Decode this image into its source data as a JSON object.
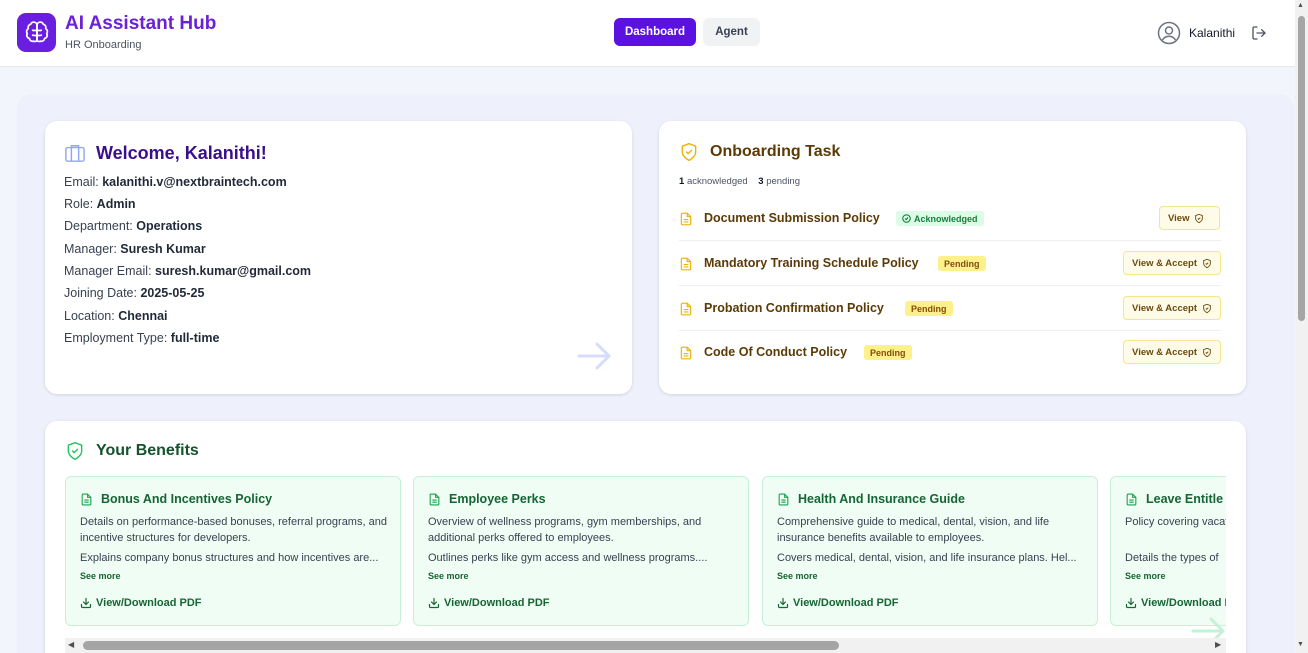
{
  "header": {
    "app_title": "AI Assistant Hub",
    "app_subtitle": "HR Onboarding",
    "nav": [
      "Dashboard",
      "Agent"
    ],
    "active_nav": "Dashboard",
    "user_name": "Kalanithi"
  },
  "welcome": {
    "title": "Welcome, Kalanithi!",
    "fields": [
      {
        "label": "Email:",
        "value": "kalanithi.v@nextbraintech.com"
      },
      {
        "label": "Role:",
        "value": "Admin"
      },
      {
        "label": "Department:",
        "value": "Operations"
      },
      {
        "label": "Manager:",
        "value": "Suresh Kumar"
      },
      {
        "label": "Manager Email:",
        "value": "suresh.kumar@gmail.com"
      },
      {
        "label": "Joining Date:",
        "value": "2025-05-25"
      },
      {
        "label": "Location:",
        "value": "Chennai"
      },
      {
        "label": "Employment Type:",
        "value": "full-time"
      }
    ]
  },
  "tasks": {
    "title": "Onboarding Task",
    "acknowledged_count": "1",
    "acknowledged_label": "acknowledged",
    "pending_count": "3",
    "pending_label": "pending",
    "items": [
      {
        "name": "Document Submission Policy",
        "status": "Acknowledged",
        "action": "View"
      },
      {
        "name": "Mandatory Training Schedule Policy",
        "status": "Pending",
        "action": "View & Accept"
      },
      {
        "name": "Probation Confirmation Policy",
        "status": "Pending",
        "action": "View & Accept"
      },
      {
        "name": "Code Of Conduct Policy",
        "status": "Pending",
        "action": "View & Accept"
      }
    ]
  },
  "benefits": {
    "title": "Your Benefits",
    "see_more": "See more",
    "download_label": "View/Download PDF",
    "items": [
      {
        "title": "Bonus And Incentives Policy",
        "description": "Details on performance-based bonuses, referral programs, and incentive structures for developers.",
        "detail": "Explains company bonus structures and how incentives are..."
      },
      {
        "title": "Employee Perks",
        "description": "Overview of wellness programs, gym memberships, and additional perks offered to employees.",
        "detail": "Outlines perks like gym access and wellness programs...."
      },
      {
        "title": "Health And Insurance Guide",
        "description": "Comprehensive guide to medical, dental, vision, and life insurance benefits available to employees.",
        "detail": "Covers medical, dental, vision, and life insurance plans. Hel..."
      },
      {
        "title": "Leave Entitle",
        "description": "Policy covering vacat other time-off benef",
        "detail": "Details the types of"
      }
    ]
  },
  "colors": {
    "brand": "#5b12e0",
    "acknowledged": "#15803d",
    "pending": "#fef08a"
  }
}
